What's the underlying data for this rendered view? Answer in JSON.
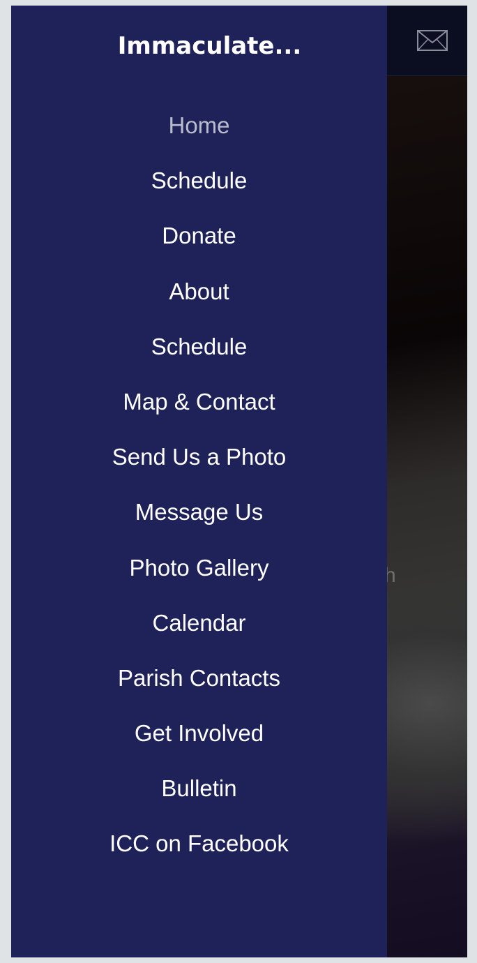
{
  "header": {
    "title": "Immaculate...",
    "mail_icon": "envelope-icon"
  },
  "background": {
    "partial_text": "ch"
  },
  "menu": {
    "active_index": 0,
    "items": [
      {
        "label": "Home"
      },
      {
        "label": "Schedule"
      },
      {
        "label": "Donate"
      },
      {
        "label": "About"
      },
      {
        "label": "Schedule"
      },
      {
        "label": "Map & Contact"
      },
      {
        "label": "Send Us a Photo"
      },
      {
        "label": "Message Us"
      },
      {
        "label": "Photo Gallery"
      },
      {
        "label": "Calendar"
      },
      {
        "label": "Parish Contacts"
      },
      {
        "label": "Get Involved"
      },
      {
        "label": "Bulletin"
      },
      {
        "label": "ICC on Facebook"
      }
    ]
  },
  "colors": {
    "drawer": "#1f2159",
    "topbar": "#0b0d20",
    "active_item": "#b9bccb"
  }
}
